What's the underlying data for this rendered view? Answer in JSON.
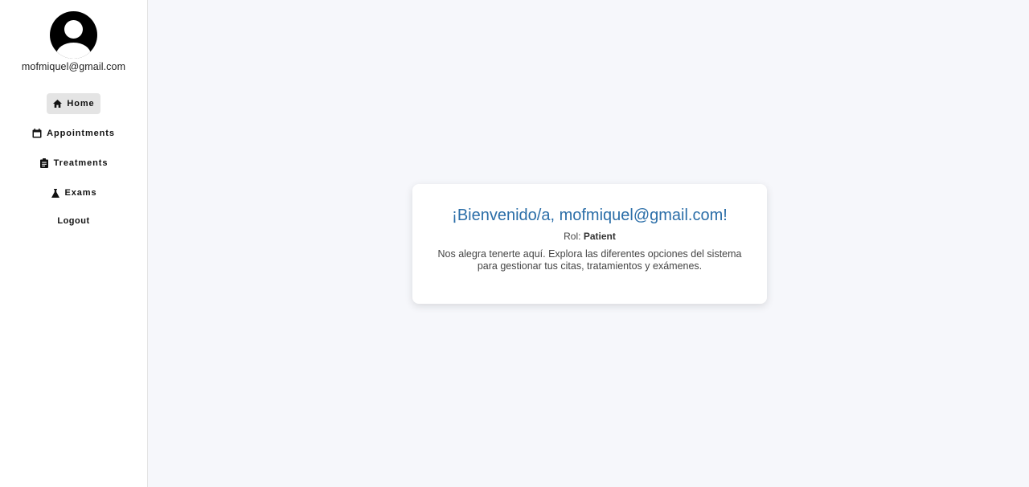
{
  "user": {
    "email": "mofmiquel@gmail.com"
  },
  "nav": {
    "items": [
      {
        "label": "Home",
        "icon": "home-icon",
        "active": true
      },
      {
        "label": "Appointments",
        "icon": "calendar-icon",
        "active": false
      },
      {
        "label": "Treatments",
        "icon": "clipboard-icon",
        "active": false
      },
      {
        "label": "Exams",
        "icon": "flask-icon",
        "active": false
      }
    ],
    "logout_label": "Logout"
  },
  "card": {
    "welcome": "¡Bienvenido/a, mofmiquel@gmail.com!",
    "role_label": "Rol:",
    "role_value": "Patient",
    "description": "Nos alegra tenerte aquí. Explora las diferentes opciones del sistema para gestionar tus citas, tratamientos y exámenes."
  },
  "colors": {
    "accent": "#2b6ea8",
    "background": "#f6f7fb",
    "active_nav": "#e4e4e4"
  }
}
